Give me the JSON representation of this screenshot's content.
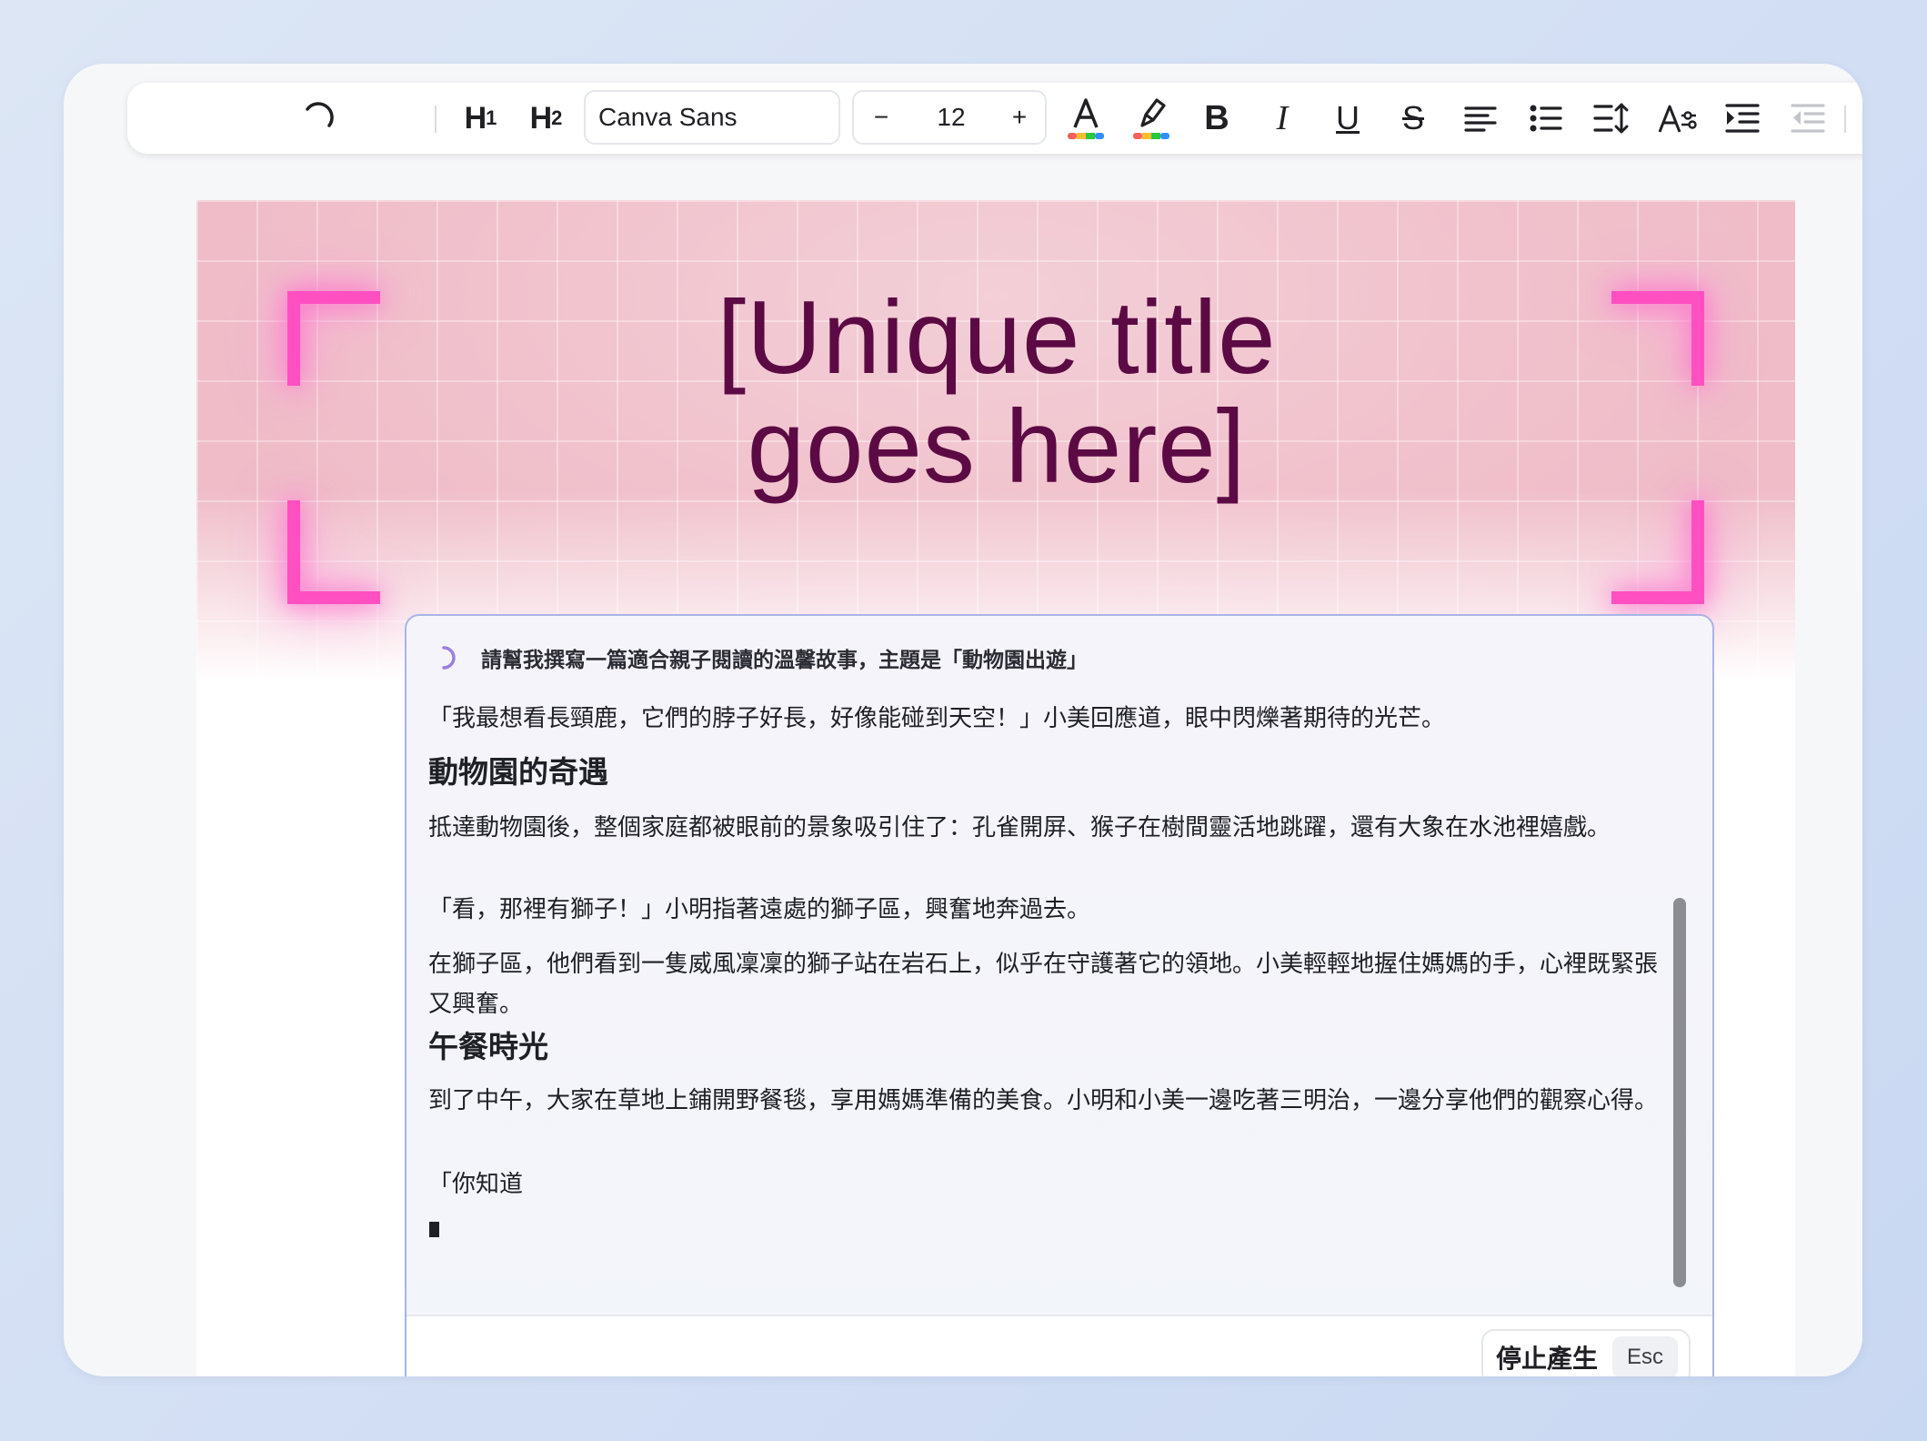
{
  "toolbar": {
    "undo_icon": "undo-arc-icon",
    "h1_label": "H",
    "h1_sub": "1",
    "h2_label": "H",
    "h2_sub": "2",
    "font_family": "Canva Sans",
    "font_size": "12",
    "decrease_label": "−",
    "increase_label": "+",
    "text_color_icon": "text-color-icon",
    "highlight_icon": "highlighter-icon",
    "bold_label": "B",
    "italic_label": "I",
    "underline_label": "U",
    "strike_label": "S"
  },
  "banner": {
    "title_line1": "[Unique title",
    "title_line2": "goes here]",
    "accent_color": "#ff4fc1",
    "title_color": "#5c0a44"
  },
  "ai_panel": {
    "prompt": "請幫我撰寫一篇適合親子閱讀的溫馨故事，主題是「動物園出遊」",
    "paragraph1": "「我最想看長頸鹿，它們的脖子好長，好像能碰到天空！」小美回應道，眼中閃爍著期待的光芒。",
    "heading1": "動物園的奇遇",
    "paragraph2": "抵達動物園後，整個家庭都被眼前的景象吸引住了：孔雀開屏、猴子在樹間靈活地跳躍，還有大象在水池裡嬉戲。",
    "paragraph3": "「看，那裡有獅子！」小明指著遠處的獅子區，興奮地奔過去。",
    "paragraph4": "在獅子區，他們看到一隻威風凜凜的獅子站在岩石上，似乎在守護著它的領地。小美輕輕地握住媽媽的手，心裡既緊張又興奮。",
    "heading2": "午餐時光",
    "paragraph5": "到了中午，大家在草地上鋪開野餐毯，享用媽媽準備的美食。小明和小美一邊吃著三明治，一邊分享他們的觀察心得。",
    "paragraph6": "「你知道",
    "stop_label": "停止產生",
    "stop_shortcut": "Esc"
  }
}
